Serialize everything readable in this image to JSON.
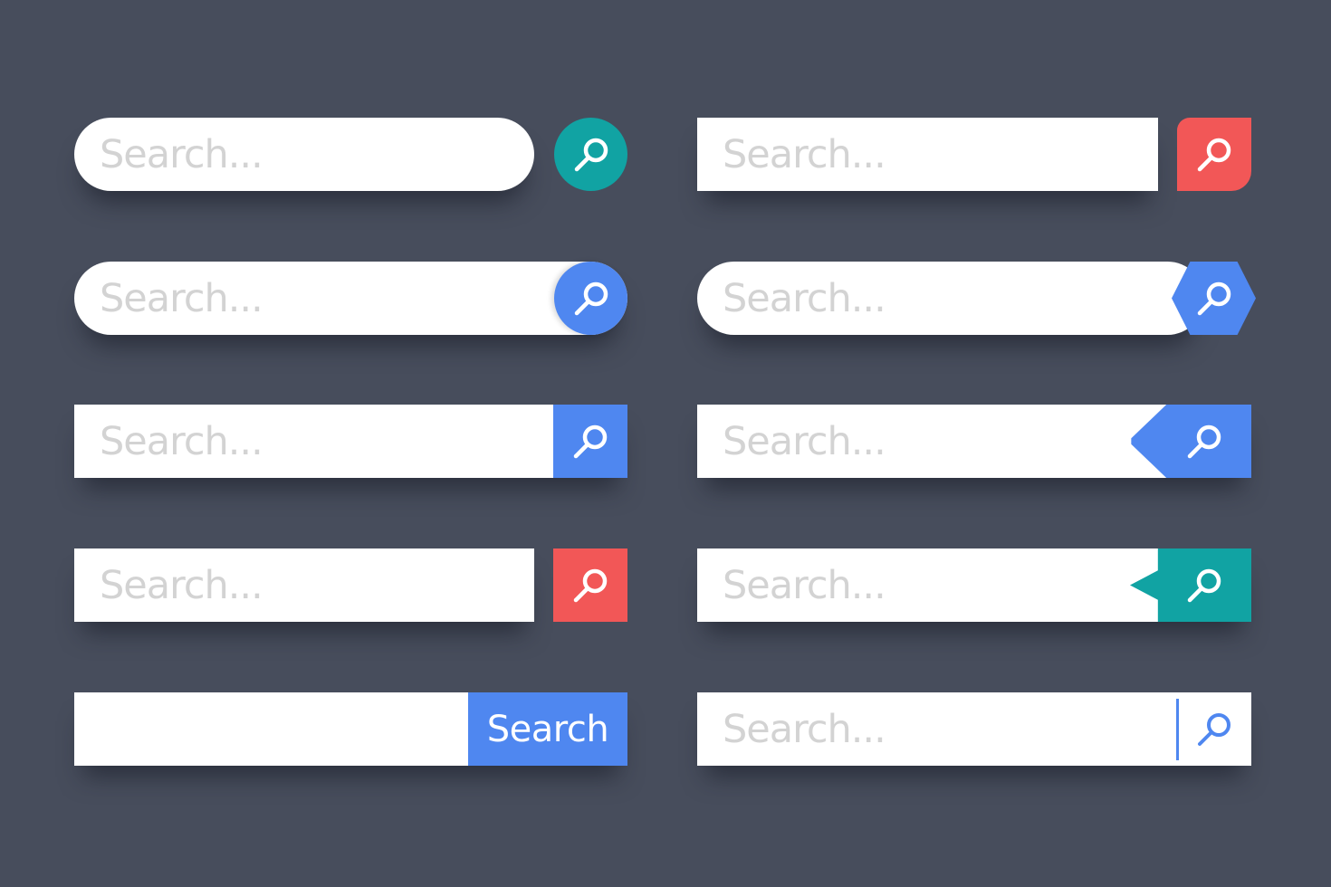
{
  "colors": {
    "background": "#474d5c",
    "teal": "#11a3a3",
    "red": "#f25757",
    "blue": "#4f87f0",
    "placeholder": "#d3d3d3"
  },
  "bars": [
    {
      "placeholder": "Search...",
      "value": "",
      "button_color": "#11a3a3",
      "button_icon": "search-icon",
      "style": "pill input with separate circle button"
    },
    {
      "placeholder": "Search...",
      "value": "",
      "button_color": "#4f87f0",
      "button_icon": "search-icon",
      "style": "pill input with attached circle button"
    },
    {
      "placeholder": "Search...",
      "value": "",
      "button_color": "#4f87f0",
      "button_icon": "search-icon",
      "style": "rectangle input with attached square button"
    },
    {
      "placeholder": "Search...",
      "value": "",
      "button_color": "#f25757",
      "button_icon": "search-icon",
      "style": "rectangle input with separate square button"
    },
    {
      "placeholder": "",
      "value": "",
      "button_color": "#4f87f0",
      "button_label": "Search",
      "style": "rectangle input with text button"
    },
    {
      "placeholder": "Search...",
      "value": "",
      "button_color": "#f25757",
      "button_icon": "search-icon",
      "style": "rectangle input with separate leaf button"
    },
    {
      "placeholder": "Search...",
      "value": "",
      "button_color": "#4f87f0",
      "button_icon": "search-icon",
      "style": "pill input with hexagon button"
    },
    {
      "placeholder": "Search...",
      "value": "",
      "button_color": "#4f87f0",
      "button_icon": "search-icon",
      "style": "rectangle input with tag button"
    },
    {
      "placeholder": "Search...",
      "value": "",
      "button_color": "#11a3a3",
      "button_icon": "search-icon",
      "style": "rectangle input with notched button"
    },
    {
      "placeholder": "Search...",
      "value": "",
      "button_color": "#4f87f0",
      "button_icon": "search-icon",
      "style": "rectangle input with divider and outline icon"
    }
  ]
}
